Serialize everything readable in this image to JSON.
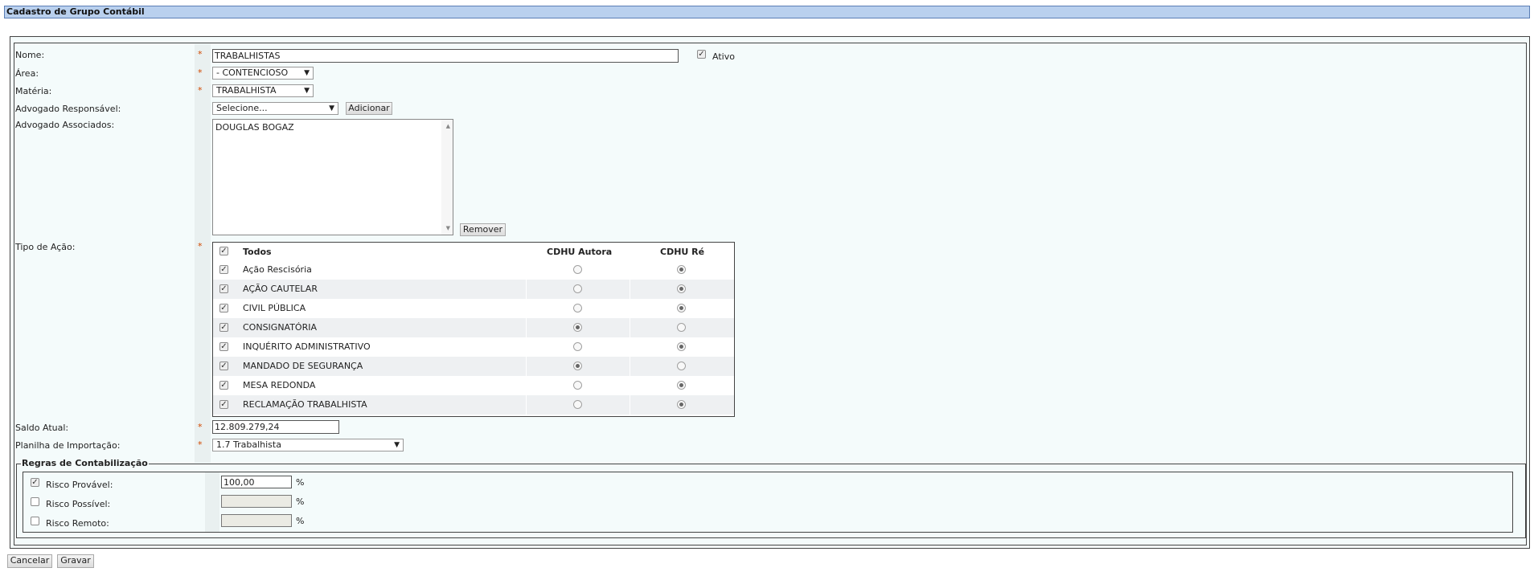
{
  "page": {
    "title": "Cadastro de Grupo Contábil"
  },
  "form": {
    "nome": {
      "label": "Nome:",
      "value": "TRABALHISTAS"
    },
    "ativo": {
      "label": "Ativo",
      "checked": true
    },
    "area": {
      "label": "Área:",
      "value": "- CONTENCIOSO"
    },
    "materia": {
      "label": "Matéria:",
      "value": "TRABALHISTA"
    },
    "advogado_responsavel": {
      "label": "Advogado Responsável:",
      "value": "Selecione...",
      "add_button": "Adicionar"
    },
    "advogados_associados": {
      "label": "Advogado Associados:",
      "items": [
        "DOUGLAS BOGAZ"
      ],
      "remove_button": "Remover"
    },
    "tipo_acao": {
      "label": "Tipo de Ação:",
      "headers": {
        "todos": "Todos",
        "autora": "CDHU Autora",
        "re": "CDHU Ré"
      },
      "rows": [
        {
          "name": "Ação Rescisória",
          "checked": true,
          "selected": "re"
        },
        {
          "name": "AÇÃO CAUTELAR",
          "checked": true,
          "selected": "re"
        },
        {
          "name": "CIVIL PÚBLICA",
          "checked": true,
          "selected": "re"
        },
        {
          "name": "CONSIGNATÓRIA",
          "checked": true,
          "selected": "autora"
        },
        {
          "name": "INQUÉRITO ADMINISTRATIVO",
          "checked": true,
          "selected": "re"
        },
        {
          "name": "MANDADO DE SEGURANÇA",
          "checked": true,
          "selected": "autora"
        },
        {
          "name": "MESA REDONDA",
          "checked": true,
          "selected": "re"
        },
        {
          "name": "RECLAMAÇÃO TRABALHISTA",
          "checked": true,
          "selected": "re"
        }
      ]
    },
    "saldo_atual": {
      "label": "Saldo Atual:",
      "value": "12.809.279,24"
    },
    "planilha": {
      "label": "Planilha de Importação:",
      "value": "1.7 Trabalhista"
    },
    "asterisk": "*"
  },
  "regras": {
    "legend": "Regras de Contabilização",
    "percent_symbol": "%",
    "items": [
      {
        "label": "Risco Provável:",
        "checked": true,
        "value": "100,00"
      },
      {
        "label": "Risco Possível:",
        "checked": false,
        "value": ""
      },
      {
        "label": "Risco Remoto:",
        "checked": false,
        "value": ""
      }
    ]
  },
  "actions": {
    "cancel": "Cancelar",
    "save": "Gravar"
  }
}
